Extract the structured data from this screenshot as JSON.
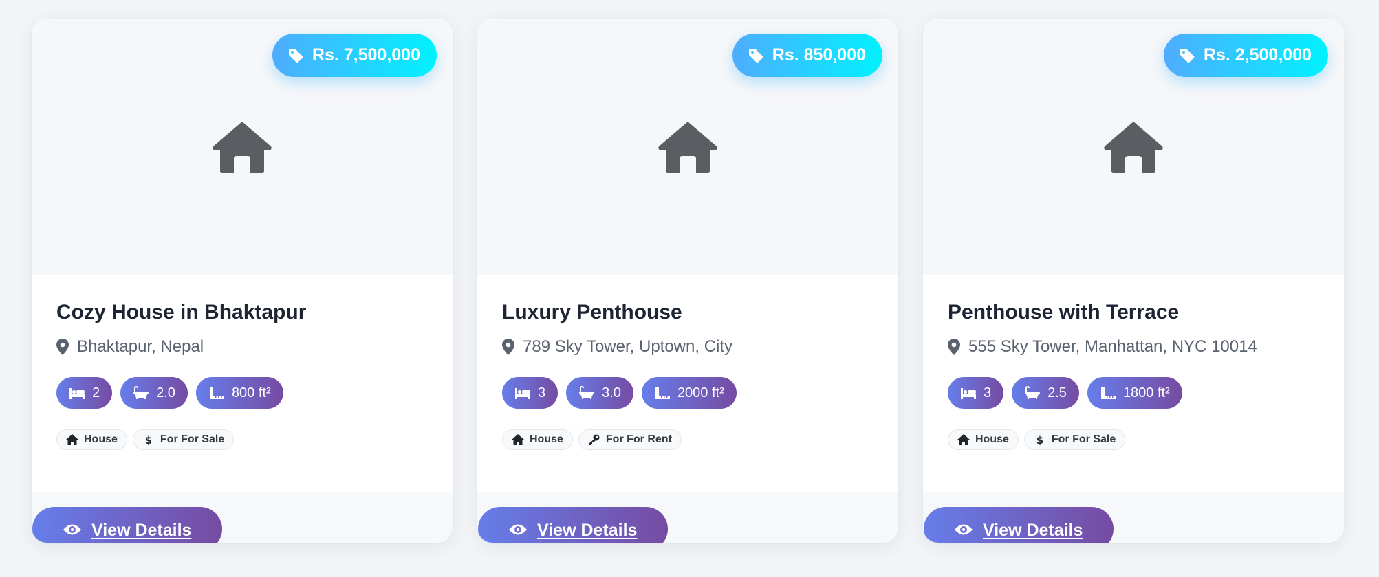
{
  "listings": [
    {
      "price": "Rs. 7,500,000",
      "title": "Cozy House in Bhaktapur",
      "location": "Bhaktapur, Nepal",
      "bedrooms": "2",
      "bathrooms": "2.0",
      "area": "800 ft²",
      "type_tag": "House",
      "status_tag": "For For Sale",
      "status_icon": "dollar-icon",
      "button": "View Details"
    },
    {
      "price": "Rs. 850,000",
      "title": "Luxury Penthouse",
      "location": "789 Sky Tower, Uptown, City",
      "bedrooms": "3",
      "bathrooms": "3.0",
      "area": "2000 ft²",
      "type_tag": "House",
      "status_tag": "For For Rent",
      "status_icon": "key-icon",
      "button": "View Details"
    },
    {
      "price": "Rs. 2,500,000",
      "title": "Penthouse with Terrace",
      "location": "555 Sky Tower, Manhattan, NYC 10014",
      "bedrooms": "3",
      "bathrooms": "2.5",
      "area": "1800 ft²",
      "type_tag": "House",
      "status_tag": "For For Sale",
      "status_icon": "dollar-icon",
      "button": "View Details"
    }
  ],
  "colors": {
    "price_gradient": [
      "#4facfe",
      "#00f2fe"
    ],
    "accent_gradient": [
      "#667eea",
      "#764ba2"
    ],
    "placeholder_icon": "#5a5e63"
  }
}
